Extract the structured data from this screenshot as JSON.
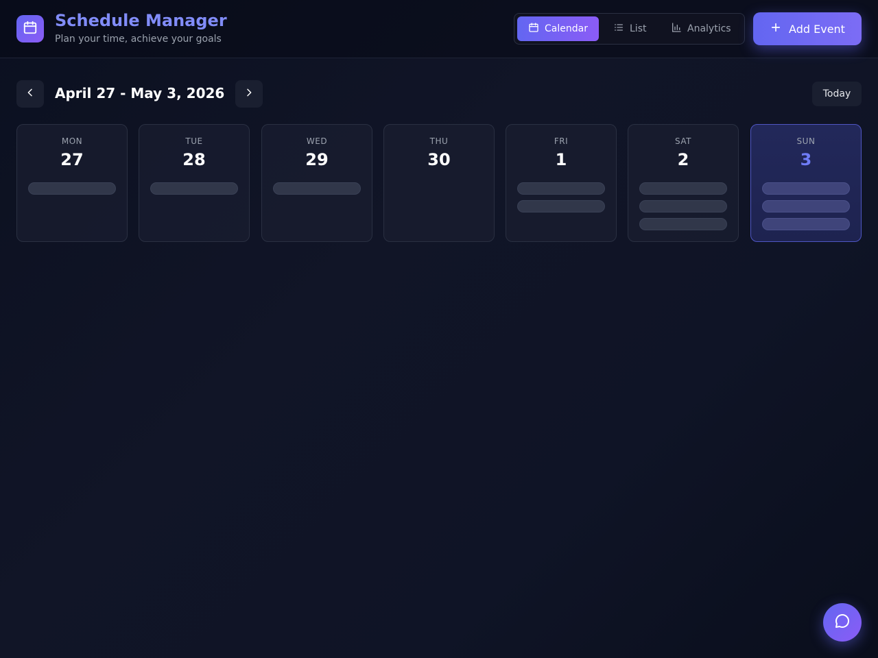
{
  "header": {
    "title": "Schedule Manager",
    "subtitle": "Plan your time, achieve your goals",
    "logo_icon": "calendar-icon",
    "views": [
      {
        "label": "Calendar",
        "icon": "calendar-icon",
        "active": true
      },
      {
        "label": "List",
        "icon": "list-icon",
        "active": false
      },
      {
        "label": "Analytics",
        "icon": "bar-chart-icon",
        "active": false
      }
    ],
    "add_event_label": "Add Event"
  },
  "week": {
    "range_label": "April 27 - May 3, 2026",
    "today_label": "Today",
    "days": [
      {
        "name": "MON",
        "number": "27",
        "event_count": 1,
        "is_today": false
      },
      {
        "name": "TUE",
        "number": "28",
        "event_count": 1,
        "is_today": false
      },
      {
        "name": "WED",
        "number": "29",
        "event_count": 1,
        "is_today": false
      },
      {
        "name": "THU",
        "number": "30",
        "event_count": 0,
        "is_today": false
      },
      {
        "name": "FRI",
        "number": "1",
        "event_count": 2,
        "is_today": false
      },
      {
        "name": "SAT",
        "number": "2",
        "event_count": 3,
        "is_today": false
      },
      {
        "name": "SUN",
        "number": "3",
        "event_count": 3,
        "is_today": true
      }
    ]
  },
  "colors": {
    "accent": "#6366f1",
    "accent_secondary": "#8b5cf6",
    "title": "#818cf8",
    "background": "#0f1426"
  },
  "chat": {
    "icon": "chat-bubble-icon"
  }
}
